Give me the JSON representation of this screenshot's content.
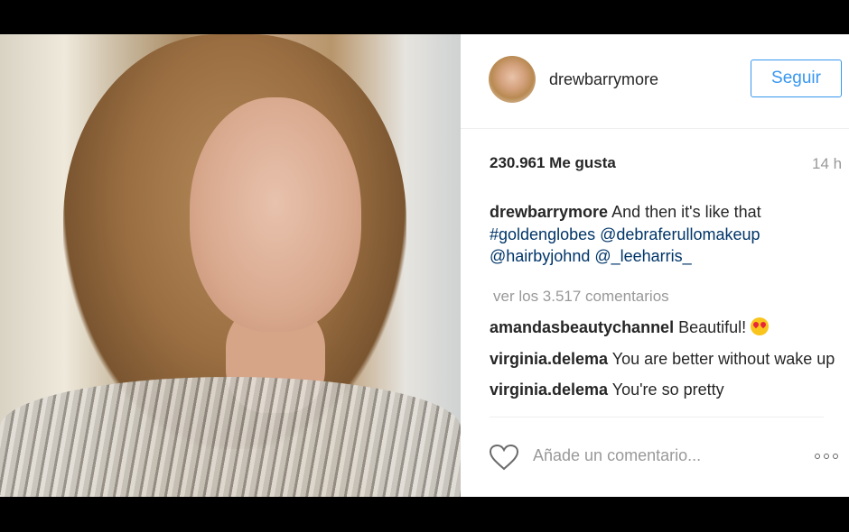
{
  "post": {
    "username": "drewbarrymore",
    "follow_label": "Seguir",
    "likes": "230.961 Me gusta",
    "time": "14 h"
  },
  "caption": {
    "user": "drewbarrymore",
    "text": "And then it's like that",
    "tags": [
      "#goldenglobes",
      "@debraferullomakeup",
      "@hairbyjohnd",
      "@_leeharris_"
    ]
  },
  "view_all_comments": "ver los 3.517 comentarios",
  "comments": [
    {
      "user": "amandasbeautychannel",
      "text": "Beautiful!",
      "emoji": "heart-eyes-emoji"
    },
    {
      "user": "virginia.delema",
      "text": "You are better without wake up"
    },
    {
      "user": "virginia.delema",
      "text": "You're so pretty"
    }
  ],
  "add_comment_placeholder": "Añade un comentario...",
  "icons": {
    "like": "heart-icon",
    "options": "more-options-icon"
  },
  "colors": {
    "accent": "#3897f0",
    "link": "#003569",
    "muted": "#999999"
  }
}
